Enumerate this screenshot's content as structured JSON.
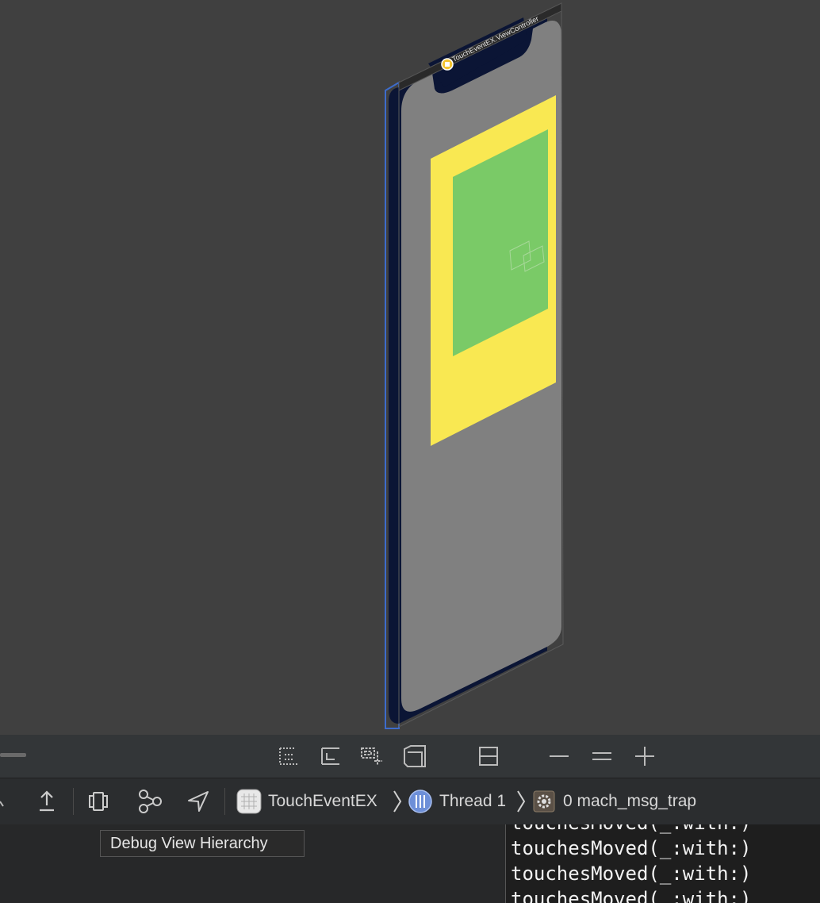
{
  "window": {
    "view_controller_label": "TouchEventEX.ViewController"
  },
  "hierarchy_controls": {
    "items": [
      "show-clipped-icon",
      "show-constraints-icon",
      "adjust-view-mode-icon",
      "orient-3d-icon",
      "wireframe-icon",
      "zoom-out-icon",
      "zoom-actual-icon",
      "zoom-in-icon"
    ]
  },
  "debug_bar": {
    "breadcrumb": {
      "app": "TouchEventEX",
      "thread": "Thread 1",
      "frame": "0 mach_msg_trap"
    },
    "tooltip": "Debug View Hierarchy"
  },
  "console": {
    "lines": [
      "touchesMoved(_:with:)",
      "touchesMoved(_:with:)",
      "touchesMoved(_:with:)",
      "touchesMoved(_:with:)"
    ]
  },
  "colors": {
    "canvas_bg": "#404040",
    "device_gray": "#808080",
    "yellow_view": "#f9e852",
    "green_view": "#7aca67",
    "window_navy": "#0b1535",
    "selection_blue": "#3d6ccc"
  }
}
